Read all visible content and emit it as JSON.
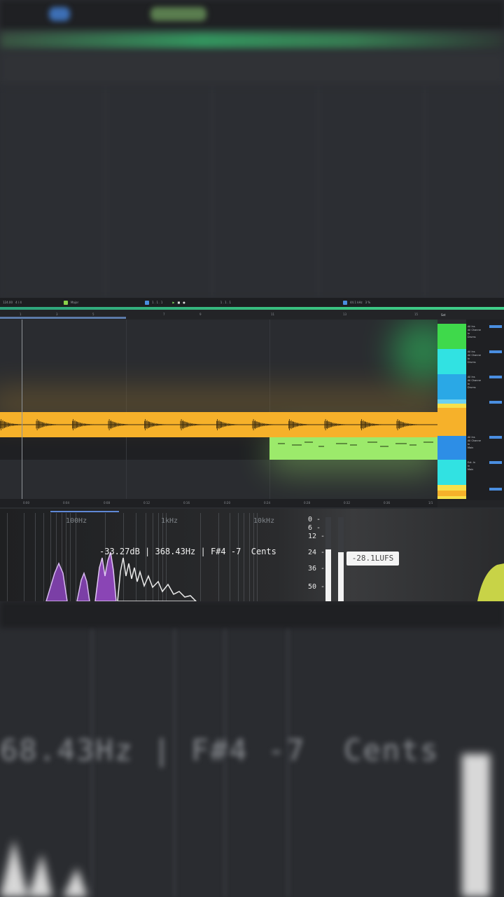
{
  "toolbar": {
    "tempo": "124.00",
    "signature": "4 / 4",
    "key": "Major",
    "position": "1 . 1 . 1",
    "loop_position": "1 . 1 . 1",
    "sample_rate": "44.1 kHz",
    "cpu": "3 %"
  },
  "ruler": {
    "bars": [
      "1",
      "3",
      "5",
      "7",
      "9",
      "11",
      "13",
      "15"
    ],
    "times": [
      "0:00",
      "0:04",
      "0:08",
      "0:12",
      "0:16",
      "0:20",
      "0:24",
      "0:28",
      "0:32",
      "0:36",
      "0:40"
    ],
    "page": "1/1"
  },
  "mixer": {
    "header": "Set",
    "tracks": [
      {
        "input": "All Ins",
        "channel": "All Channe",
        "monitor": "In",
        "auto": "Auto",
        "off": "Off",
        "out": "Drums",
        "color": "#3fd94b"
      },
      {
        "input": "All Ins",
        "channel": "All Channe",
        "monitor": "In",
        "auto": "Auto",
        "off": "Off",
        "out": "Drums",
        "color": "#31e2e2"
      },
      {
        "input": "All Ins",
        "channel": "All Channe",
        "monitor": "In",
        "auto": "Auto",
        "off": "Off",
        "out": "Drums",
        "color": "#2aa8e6"
      },
      {
        "input": "",
        "channel": "",
        "monitor": "",
        "auto": "",
        "off": "",
        "out": "",
        "color": "#f6b12a"
      },
      {
        "input": "All Ins",
        "channel": "All Channe",
        "monitor": "In",
        "auto": "Auto",
        "off": "Off",
        "out": "Main",
        "color": "#2d8ee6"
      },
      {
        "input": "Ext. In",
        "channel": "",
        "monitor": "In",
        "auto": "Auto",
        "off": "Off",
        "out": "Main",
        "color": "#31e2e2"
      }
    ]
  },
  "analyzer": {
    "freq_labels": [
      "100Hz",
      "1kHz",
      "10kHz"
    ],
    "readout": "-33.27dB | 368.43Hz | F#4 -7  Cents",
    "db_scale": [
      "0 -",
      "6 -",
      "12 -",
      "24 -",
      "36 -",
      "50 -"
    ],
    "lufs": "-28.1LUFS",
    "meter_levels": [
      0.62,
      0.58
    ]
  },
  "bottom_blur": {
    "big_readout": "68.43Hz | F#4 -7  Cents"
  },
  "colors": {
    "audio_clip": "#f6b12a",
    "midi_clip": "#9cea6b",
    "accent_green": "#39c07f",
    "accent_blue": "#4a8ee0"
  }
}
